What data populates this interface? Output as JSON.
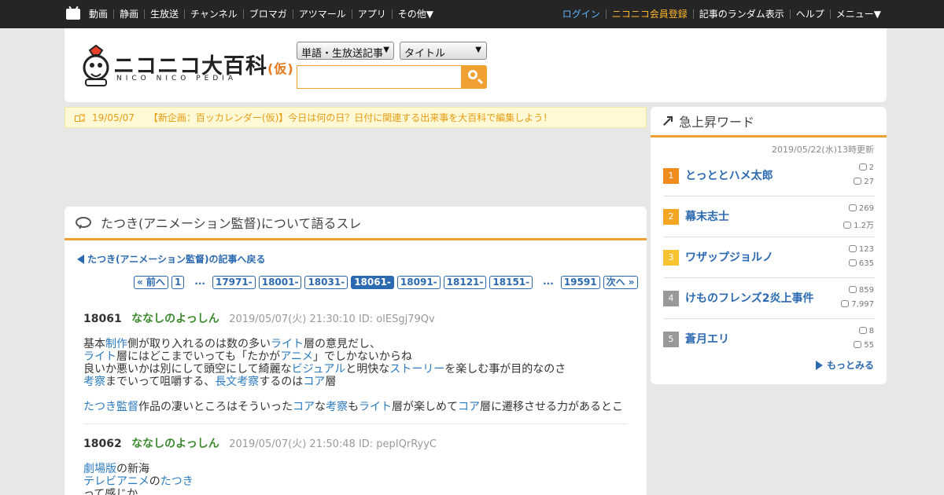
{
  "topnav": {
    "items": [
      "動画",
      "静画",
      "生放送",
      "チャンネル",
      "ブロマガ",
      "アツマール",
      "アプリ",
      "その他▼"
    ],
    "login": "ログイン",
    "register": "ニコニコ会員登録",
    "random": "記事のランダム表示",
    "help": "ヘルプ",
    "menu": "メニュー▼"
  },
  "logo": {
    "title": "ニコニコ大百科",
    "kari": "(仮)",
    "sub": "NICO NICO PEDIA"
  },
  "search": {
    "category": "単語・生放送記事",
    "field": "タイトル",
    "placeholder": ""
  },
  "notice": {
    "date": "19/05/07",
    "text": "【新企画：百ッカレンダー(仮)】今日は何の日？日付に関連する出来事を大百科で編集しよう！"
  },
  "thread": {
    "title": "たつき(アニメーション監督)について語るスレ",
    "back": "たつき(アニメーション監督)の記事へ戻る",
    "pager": [
      "« 前へ",
      "1",
      "...",
      "17971-",
      "18001-",
      "18031-",
      "18061-",
      "18091-",
      "18121-",
      "18151-",
      "...",
      "19591",
      "次へ »"
    ],
    "posts": [
      {
        "num": "18061",
        "name": "ななしのよっしん",
        "meta": "2019/05/07(火) 21:30:10 ID: olESgj79Qv"
      },
      {
        "num": "18062",
        "name": "ななしのよっしん",
        "meta": "2019/05/07(火) 21:50:48 ID: pepIQrRyyC"
      }
    ],
    "p1": {
      "l1a": "基本",
      "l1b": "制作",
      "l1c": "側が取り入れるのは数の多い",
      "l1d": "ライト",
      "l1e": "層の意見だし、",
      "l2a": "ライト",
      "l2b": "層にはどこまでいっても「たかが",
      "l2c": "アニメ",
      "l2d": "」でしかないからね",
      "l3a": "良いか悪いかは別にして頭空にして綺麗な",
      "l3b": "ビジュアル",
      "l3c": "と明快な",
      "l3d": "ストーリー",
      "l3e": "を楽しむ事が目的なのさ",
      "l4a": "考察",
      "l4b": "までいって咀嚼する、",
      "l4c": "長文考察",
      "l4d": "するのは",
      "l4e": "コア",
      "l4f": "層",
      "l5a": "たつき監督",
      "l5b": "作品の凄いところはそういった",
      "l5c": "コア",
      "l5d": "な",
      "l5e": "考察",
      "l5f": "も",
      "l5g": "ライト",
      "l5h": "層が楽しめて",
      "l5i": "コア",
      "l5j": "層に遷移させる力があるとこ"
    },
    "p2": {
      "l1a": "劇場版",
      "l1b": "の新海",
      "l2a": "テレビアニメ",
      "l2b": "の",
      "l2c": "たつき",
      "l3a": "って感じか"
    }
  },
  "side": {
    "title": "急上昇ワード",
    "updated": "2019/05/22(水)13時更新",
    "more": "もっとみる",
    "ranks": [
      {
        "rank": "1",
        "word": "とっととハメ太郎",
        "a": "2",
        "b": "27",
        "color": "#f08c1e"
      },
      {
        "rank": "2",
        "word": "幕末志士",
        "a": "269",
        "b": "1.2万",
        "color": "#f5a623"
      },
      {
        "rank": "3",
        "word": "ワザップジョルノ",
        "a": "123",
        "b": "635",
        "color": "#f7c331"
      },
      {
        "rank": "4",
        "word": "けものフレンズ2炎上事件",
        "a": "859",
        "b": "7,997",
        "color": "#999999"
      },
      {
        "rank": "5",
        "word": "蒼月エリ",
        "a": "8",
        "b": "55",
        "color": "#999999"
      }
    ]
  }
}
